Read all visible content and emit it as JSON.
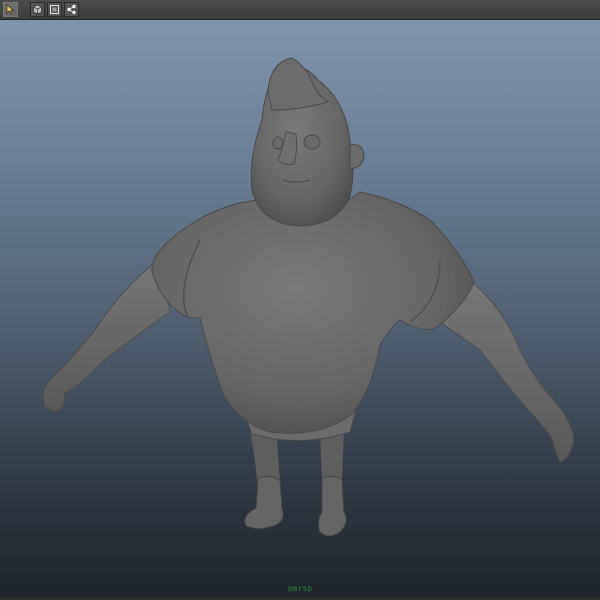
{
  "toolbar": {
    "tools": [
      {
        "name": "select-tool",
        "icon": "select-arrow-icon",
        "active": true
      },
      {
        "name": "cube-view-tool",
        "icon": "cube-icon",
        "active": false
      },
      {
        "name": "frame-tool",
        "icon": "frame-icon",
        "active": false
      },
      {
        "name": "share-tool",
        "icon": "share-nodes-icon",
        "active": false
      }
    ]
  },
  "viewport": {
    "camera_label": "persp",
    "background_top": "#7f93aa",
    "background_bottom": "#1f252b",
    "model_color": "#6c6c6c"
  }
}
